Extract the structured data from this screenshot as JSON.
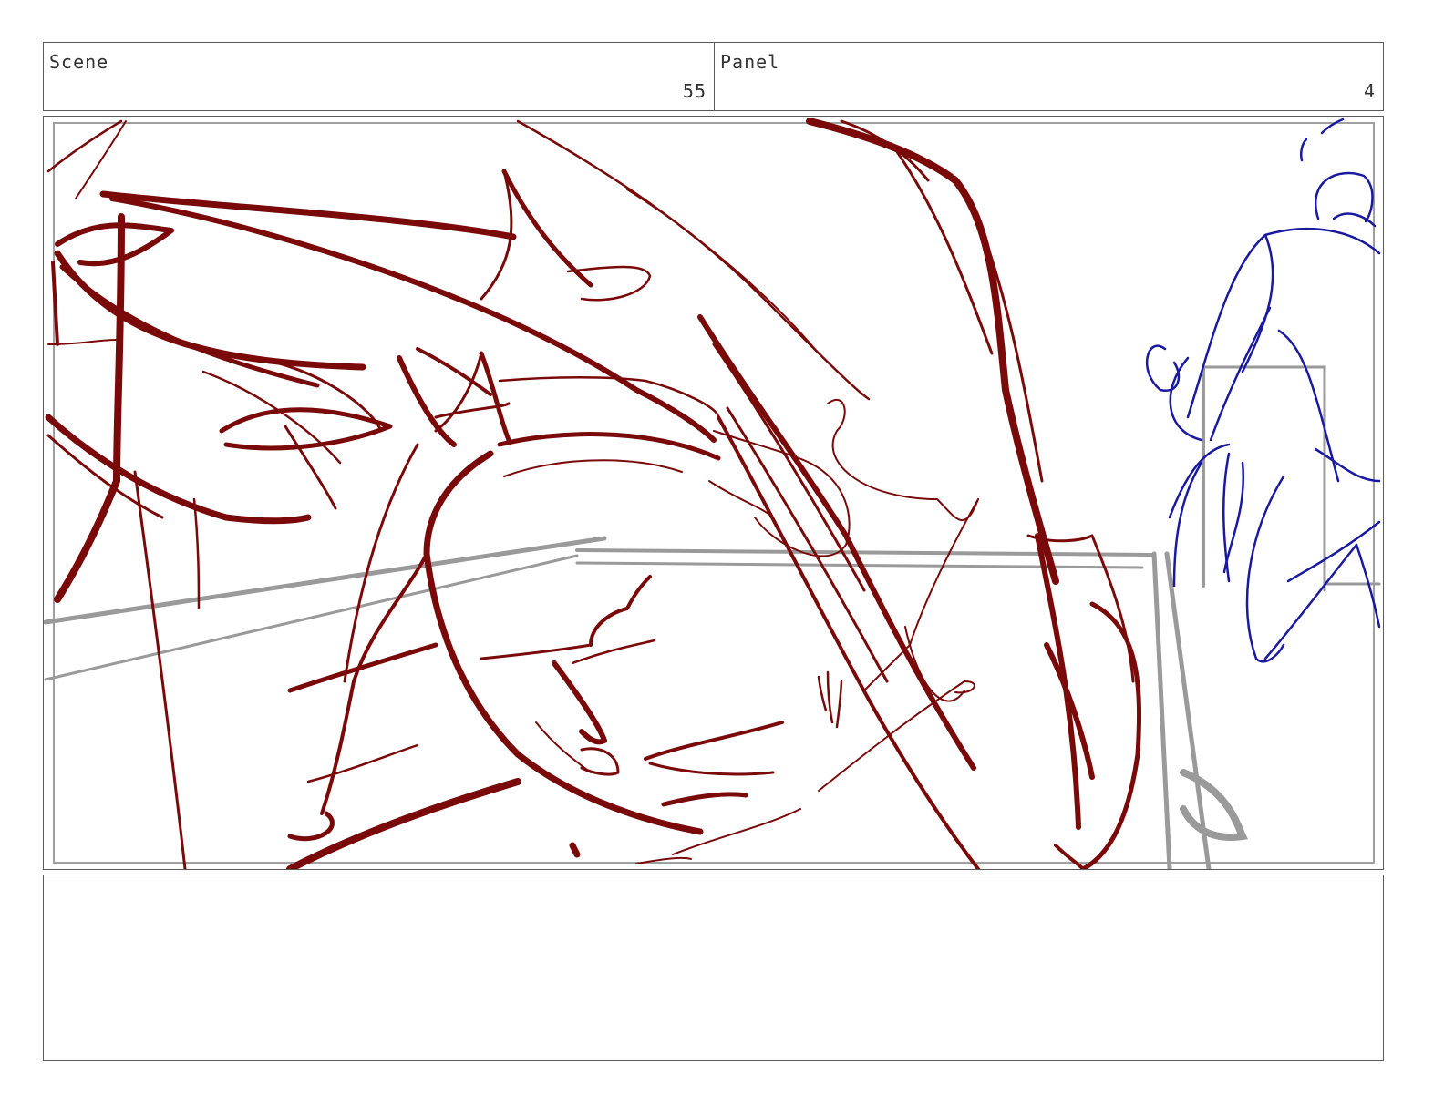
{
  "header": {
    "scene_label": "Scene",
    "scene_value": "55",
    "panel_label": "Panel",
    "panel_value": "4"
  },
  "drawing": {
    "primary_stroke_color": "#7a0a0a",
    "secondary_stroke_color": "#1a1aa0",
    "background_guide_color": "#9a9a9a",
    "safe_frame_color": "#a0a0a0"
  },
  "notes": {
    "text": ""
  }
}
